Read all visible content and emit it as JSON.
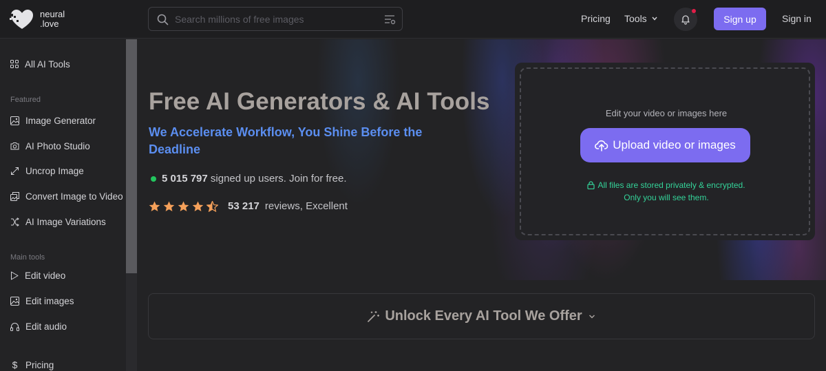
{
  "header": {
    "logo_line1": "neural",
    "logo_line2": ".love",
    "search_placeholder": "Search millions of free images",
    "pricing": "Pricing",
    "tools": "Tools",
    "signup": "Sign up",
    "signin": "Sign in"
  },
  "sidebar": {
    "all_tools": "All AI Tools",
    "featured_heading": "Featured",
    "featured": [
      {
        "label": "Image Generator",
        "icon": "image-icon"
      },
      {
        "label": "AI Photo Studio",
        "icon": "camera-icon"
      },
      {
        "label": "Uncrop Image",
        "icon": "expand-icon"
      },
      {
        "label": "Convert Image to Video",
        "icon": "image-to-video-icon"
      },
      {
        "label": "AI Image Variations",
        "icon": "shuffle-icon"
      }
    ],
    "main_heading": "Main tools",
    "main": [
      {
        "label": "Edit video",
        "icon": "play-icon"
      },
      {
        "label": "Edit images",
        "icon": "image-icon"
      },
      {
        "label": "Edit audio",
        "icon": "headphones-icon"
      }
    ],
    "pricing": "Pricing"
  },
  "hero": {
    "title": "Free AI Generators & AI Tools",
    "subtitle": "We Accelerate Workflow, You Shine Before the Deadline",
    "users_count": "5 015 797",
    "users_text": "signed up users. Join for free.",
    "rating_stars": 4.5,
    "reviews_count": "53 217",
    "reviews_text": "reviews, Excellent"
  },
  "upload": {
    "hint": "Edit your video or images here",
    "button": "Upload video or images",
    "private_line1": "All files are stored privately & encrypted.",
    "private_line2": "Only you will see them."
  },
  "unlock": {
    "label": "Unlock Every AI Tool We Offer"
  },
  "colors": {
    "accent": "#7c6cf0",
    "subtitle": "#5b8ef0",
    "success": "#22c55e",
    "private": "#34d399",
    "star": "#f5a05a"
  }
}
